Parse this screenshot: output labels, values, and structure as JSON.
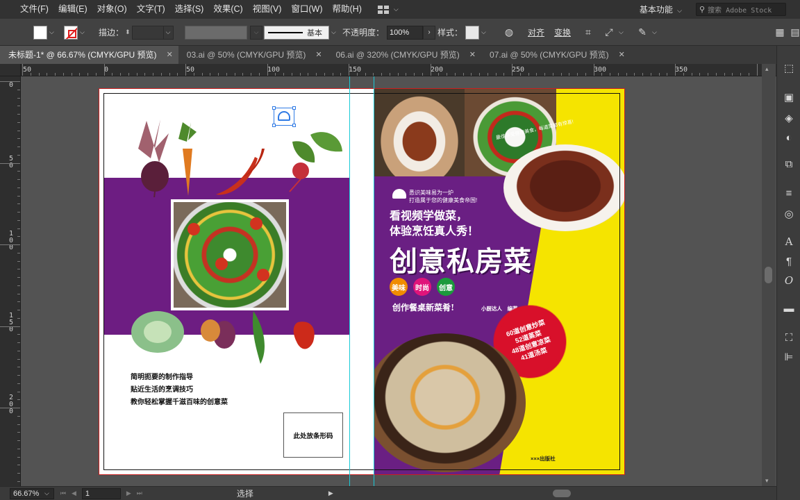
{
  "menu": {
    "items": [
      "文件(F)",
      "编辑(E)",
      "对象(O)",
      "文字(T)",
      "选择(S)",
      "效果(C)",
      "视图(V)",
      "窗口(W)",
      "帮助(H)"
    ],
    "workspace": "基本功能",
    "stock_search_placeholder": "搜索 Adobe Stock"
  },
  "control_bar": {
    "stroke_label": "描边：",
    "stroke_style": "基本",
    "opacity_label": "不透明度：",
    "opacity_value": "100%",
    "style_label": "样式：",
    "align_label": "对齐",
    "transform_label": "变换"
  },
  "tabs": [
    {
      "label": "未标题-1* @ 66.67% (CMYK/GPU 预览)",
      "active": true
    },
    {
      "label": "03.ai @ 50% (CMYK/GPU 预览)",
      "active": false
    },
    {
      "label": "06.ai @ 320% (CMYK/GPU 预览)",
      "active": false
    },
    {
      "label": "07.ai @ 50% (CMYK/GPU 预览)",
      "active": false
    }
  ],
  "ruler_h": [
    "50",
    "0",
    "50",
    "100",
    "150",
    "200",
    "250",
    "300",
    "350"
  ],
  "ruler_v": [
    "0",
    "5\n0",
    "1\n0\n0",
    "1\n5\n0",
    "2\n0\n0"
  ],
  "back_cover": {
    "lines": [
      "简明扼要的制作指导",
      "贴近生活的烹调技巧",
      "教你轻松掌握千滋百味的创意菜"
    ],
    "barcode_label": "此处放条形码"
  },
  "front_cover": {
    "logo_line1": "悉识美味易为一炉",
    "logo_line2": "打造属于您的健康美食帝国!",
    "slogan_line1": "看视频学做菜，",
    "slogan_line2": "体验烹饪真人秀！",
    "title": "创意私房菜",
    "tags": [
      "美味",
      "时尚",
      "创意"
    ],
    "subtitle": "创作餐桌新菜肴!",
    "author": "小厨达人　编著",
    "badge_lines": [
      "60道创意炒菜",
      "52道蒸菜",
      "48道创意凉菜",
      "41道汤菜"
    ],
    "publisher": "×××出版社",
    "photo_tag": "最佳享受健康美食，每道菜都有惊喜!"
  },
  "status_bar": {
    "zoom": "66.67%",
    "page": "1",
    "tool": "选择"
  },
  "colors": {
    "purple": "#6d1d82",
    "yellow": "#f5e400",
    "badge_red": "#d8102a",
    "guide": "#18c9d6",
    "bleed": "#cc1f1f",
    "tag_colors": [
      "#f08c00",
      "#e0147a",
      "#1c9a3c"
    ]
  }
}
